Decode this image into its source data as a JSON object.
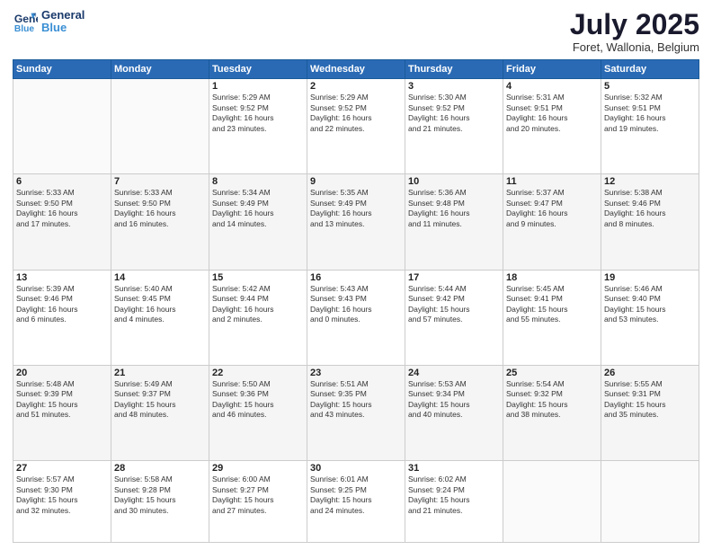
{
  "header": {
    "logo_line1": "General",
    "logo_line2": "Blue",
    "title": "July 2025",
    "subtitle": "Foret, Wallonia, Belgium"
  },
  "weekdays": [
    "Sunday",
    "Monday",
    "Tuesday",
    "Wednesday",
    "Thursday",
    "Friday",
    "Saturday"
  ],
  "weeks": [
    [
      {
        "day": "",
        "info": ""
      },
      {
        "day": "",
        "info": ""
      },
      {
        "day": "1",
        "info": "Sunrise: 5:29 AM\nSunset: 9:52 PM\nDaylight: 16 hours\nand 23 minutes."
      },
      {
        "day": "2",
        "info": "Sunrise: 5:29 AM\nSunset: 9:52 PM\nDaylight: 16 hours\nand 22 minutes."
      },
      {
        "day": "3",
        "info": "Sunrise: 5:30 AM\nSunset: 9:52 PM\nDaylight: 16 hours\nand 21 minutes."
      },
      {
        "day": "4",
        "info": "Sunrise: 5:31 AM\nSunset: 9:51 PM\nDaylight: 16 hours\nand 20 minutes."
      },
      {
        "day": "5",
        "info": "Sunrise: 5:32 AM\nSunset: 9:51 PM\nDaylight: 16 hours\nand 19 minutes."
      }
    ],
    [
      {
        "day": "6",
        "info": "Sunrise: 5:33 AM\nSunset: 9:50 PM\nDaylight: 16 hours\nand 17 minutes."
      },
      {
        "day": "7",
        "info": "Sunrise: 5:33 AM\nSunset: 9:50 PM\nDaylight: 16 hours\nand 16 minutes."
      },
      {
        "day": "8",
        "info": "Sunrise: 5:34 AM\nSunset: 9:49 PM\nDaylight: 16 hours\nand 14 minutes."
      },
      {
        "day": "9",
        "info": "Sunrise: 5:35 AM\nSunset: 9:49 PM\nDaylight: 16 hours\nand 13 minutes."
      },
      {
        "day": "10",
        "info": "Sunrise: 5:36 AM\nSunset: 9:48 PM\nDaylight: 16 hours\nand 11 minutes."
      },
      {
        "day": "11",
        "info": "Sunrise: 5:37 AM\nSunset: 9:47 PM\nDaylight: 16 hours\nand 9 minutes."
      },
      {
        "day": "12",
        "info": "Sunrise: 5:38 AM\nSunset: 9:46 PM\nDaylight: 16 hours\nand 8 minutes."
      }
    ],
    [
      {
        "day": "13",
        "info": "Sunrise: 5:39 AM\nSunset: 9:46 PM\nDaylight: 16 hours\nand 6 minutes."
      },
      {
        "day": "14",
        "info": "Sunrise: 5:40 AM\nSunset: 9:45 PM\nDaylight: 16 hours\nand 4 minutes."
      },
      {
        "day": "15",
        "info": "Sunrise: 5:42 AM\nSunset: 9:44 PM\nDaylight: 16 hours\nand 2 minutes."
      },
      {
        "day": "16",
        "info": "Sunrise: 5:43 AM\nSunset: 9:43 PM\nDaylight: 16 hours\nand 0 minutes."
      },
      {
        "day": "17",
        "info": "Sunrise: 5:44 AM\nSunset: 9:42 PM\nDaylight: 15 hours\nand 57 minutes."
      },
      {
        "day": "18",
        "info": "Sunrise: 5:45 AM\nSunset: 9:41 PM\nDaylight: 15 hours\nand 55 minutes."
      },
      {
        "day": "19",
        "info": "Sunrise: 5:46 AM\nSunset: 9:40 PM\nDaylight: 15 hours\nand 53 minutes."
      }
    ],
    [
      {
        "day": "20",
        "info": "Sunrise: 5:48 AM\nSunset: 9:39 PM\nDaylight: 15 hours\nand 51 minutes."
      },
      {
        "day": "21",
        "info": "Sunrise: 5:49 AM\nSunset: 9:37 PM\nDaylight: 15 hours\nand 48 minutes."
      },
      {
        "day": "22",
        "info": "Sunrise: 5:50 AM\nSunset: 9:36 PM\nDaylight: 15 hours\nand 46 minutes."
      },
      {
        "day": "23",
        "info": "Sunrise: 5:51 AM\nSunset: 9:35 PM\nDaylight: 15 hours\nand 43 minutes."
      },
      {
        "day": "24",
        "info": "Sunrise: 5:53 AM\nSunset: 9:34 PM\nDaylight: 15 hours\nand 40 minutes."
      },
      {
        "day": "25",
        "info": "Sunrise: 5:54 AM\nSunset: 9:32 PM\nDaylight: 15 hours\nand 38 minutes."
      },
      {
        "day": "26",
        "info": "Sunrise: 5:55 AM\nSunset: 9:31 PM\nDaylight: 15 hours\nand 35 minutes."
      }
    ],
    [
      {
        "day": "27",
        "info": "Sunrise: 5:57 AM\nSunset: 9:30 PM\nDaylight: 15 hours\nand 32 minutes."
      },
      {
        "day": "28",
        "info": "Sunrise: 5:58 AM\nSunset: 9:28 PM\nDaylight: 15 hours\nand 30 minutes."
      },
      {
        "day": "29",
        "info": "Sunrise: 6:00 AM\nSunset: 9:27 PM\nDaylight: 15 hours\nand 27 minutes."
      },
      {
        "day": "30",
        "info": "Sunrise: 6:01 AM\nSunset: 9:25 PM\nDaylight: 15 hours\nand 24 minutes."
      },
      {
        "day": "31",
        "info": "Sunrise: 6:02 AM\nSunset: 9:24 PM\nDaylight: 15 hours\nand 21 minutes."
      },
      {
        "day": "",
        "info": ""
      },
      {
        "day": "",
        "info": ""
      }
    ]
  ]
}
